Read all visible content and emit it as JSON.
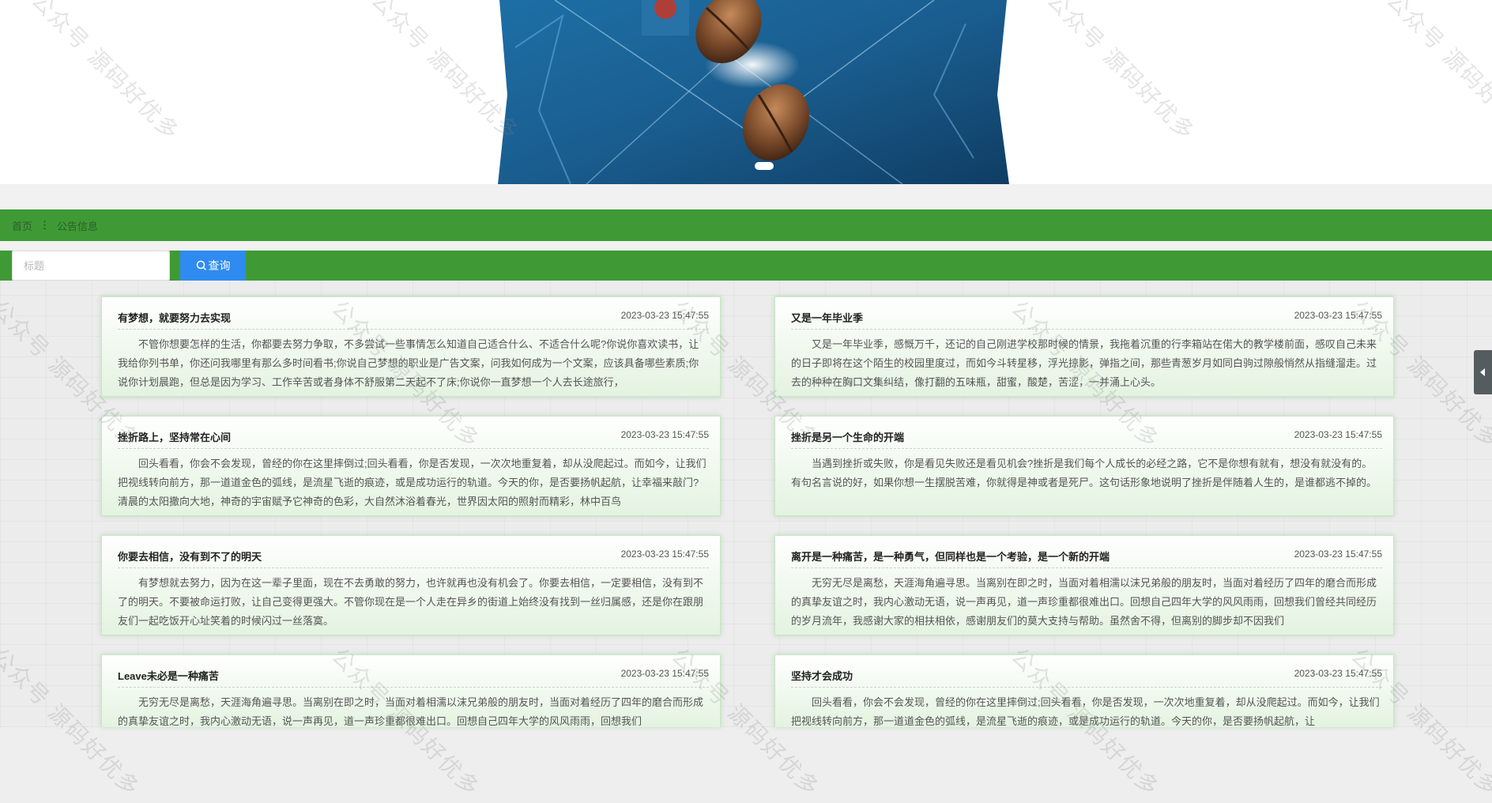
{
  "banner": {
    "active_slide": 1,
    "slide_count": 1
  },
  "breadcrumb": {
    "home": "首页",
    "separator": "⋮",
    "current": "公告信息"
  },
  "search": {
    "placeholder": "标题",
    "value": "",
    "button_label": "查询"
  },
  "notices": [
    {
      "title": "有梦想，就要努力去实现",
      "time": "2023-03-23 15:47:55",
      "content": "不管你想要怎样的生活，你都要去努力争取，不多尝试一些事情怎么知道自己适合什么、不适合什么呢?你说你喜欢读书，让我给你列书单，你还问我哪里有那么多时间看书;你说自己梦想的职业是广告文案，问我如何成为一个文案，应该具备哪些素质;你说你计划晨跑，但总是因为学习、工作辛苦或者身体不舒服第二天起不了床;你说你一直梦想一个人去长途旅行，"
    },
    {
      "title": "又是一年毕业季",
      "time": "2023-03-23 15:47:55",
      "content": "又是一年毕业季，感慨万千，还记的自己刚进学校那时候的情景，我拖着沉重的行李箱站在偌大的教学楼前面，感叹自己未来的日子即将在这个陌生的校园里度过，而如今斗转星移，浮光掠影，弹指之间，那些青葱岁月如同白驹过隙般悄然从指缝溜走。过去的种种在胸口文集纠结，像打翻的五味瓶，甜蜜，酸楚，苦涩，一并涌上心头。"
    },
    {
      "title": "挫折路上，坚持常在心间",
      "time": "2023-03-23 15:47:55",
      "content": "回头看看，你会不会发现，曾经的你在这里摔倒过;回头看看，你是否发现，一次次地重复着，却从没爬起过。而如今，让我们把视线转向前方，那一道道金色的弧线，是流星飞逝的痕迹，或是成功运行的轨道。今天的你，是否要扬帆起航，让幸福来敲门?清晨的太阳撒向大地，神奇的宇宙赋予它神奇的色彩，大自然沐浴着春光，世界因太阳的照射而精彩，林中百鸟"
    },
    {
      "title": "挫折是另一个生命的开端",
      "time": "2023-03-23 15:47:55",
      "content": "当遇到挫折或失败，你是看见失败还是看见机会?挫折是我们每个人成长的必经之路，它不是你想有就有，想没有就没有的。有句名言说的好，如果你想一生摆脱苦难，你就得是神或者是死尸。这句话形象地说明了挫折是伴随着人生的，是谁都逃不掉的。"
    },
    {
      "title": "你要去相信，没有到不了的明天",
      "time": "2023-03-23 15:47:55",
      "content": "有梦想就去努力，因为在这一辈子里面，现在不去勇敢的努力，也许就再也没有机会了。你要去相信，一定要相信，没有到不了的明天。不要被命运打败，让自己变得更强大。不管你现在是一个人走在异乡的街道上始终没有找到一丝归属感，还是你在跟朋友们一起吃饭开心址笑着的时候闪过一丝落寞。"
    },
    {
      "title": "离开是一种痛苦，是一种勇气，但同样也是一个考验，是一个新的开端",
      "time": "2023-03-23 15:47:55",
      "content": "无穷无尽是离愁，天涯海角遍寻思。当离别在即之时，当面对着相濡以沫兄弟般的朋友时，当面对着经历了四年的磨合而形成的真挚友谊之时，我内心激动无语，说一声再见，道一声珍重都很难出口。回想自己四年大学的风风雨雨，回想我们曾经共同经历的岁月流年，我感谢大家的相扶相依，感谢朋友们的莫大支持与帮助。虽然舍不得，但离别的脚步却不因我们"
    },
    {
      "title": "Leave未必是一种痛苦",
      "time": "2023-03-23 15:47:55",
      "content": "无穷无尽是离愁，天涯海角遍寻思。当离别在即之时，当面对着相濡以沫兄弟般的朋友时，当面对着经历了四年的磨合而形成的真挚友谊之时，我内心激动无语，说一声再见，道一声珍重都很难出口。回想自己四年大学的风风雨雨，回想我们"
    },
    {
      "title": "坚持才会成功",
      "time": "2023-03-23 15:47:55",
      "content": "回头看看，你会不会发现，曾经的你在这里摔倒过;回头看看，你是否发现，一次次地重复着，却从没爬起过。而如今，让我们把视线转向前方，那一道道金色的弧线，是流星飞逝的痕迹，或是成功运行的轨道。今天的你，是否要扬帆起航，让"
    }
  ],
  "watermark": {
    "text": "公众号 源码好优多"
  },
  "colors": {
    "accent_green": "#3f9a35",
    "button_blue": "#2f8bf0",
    "card_border": "#c8e6c3"
  }
}
